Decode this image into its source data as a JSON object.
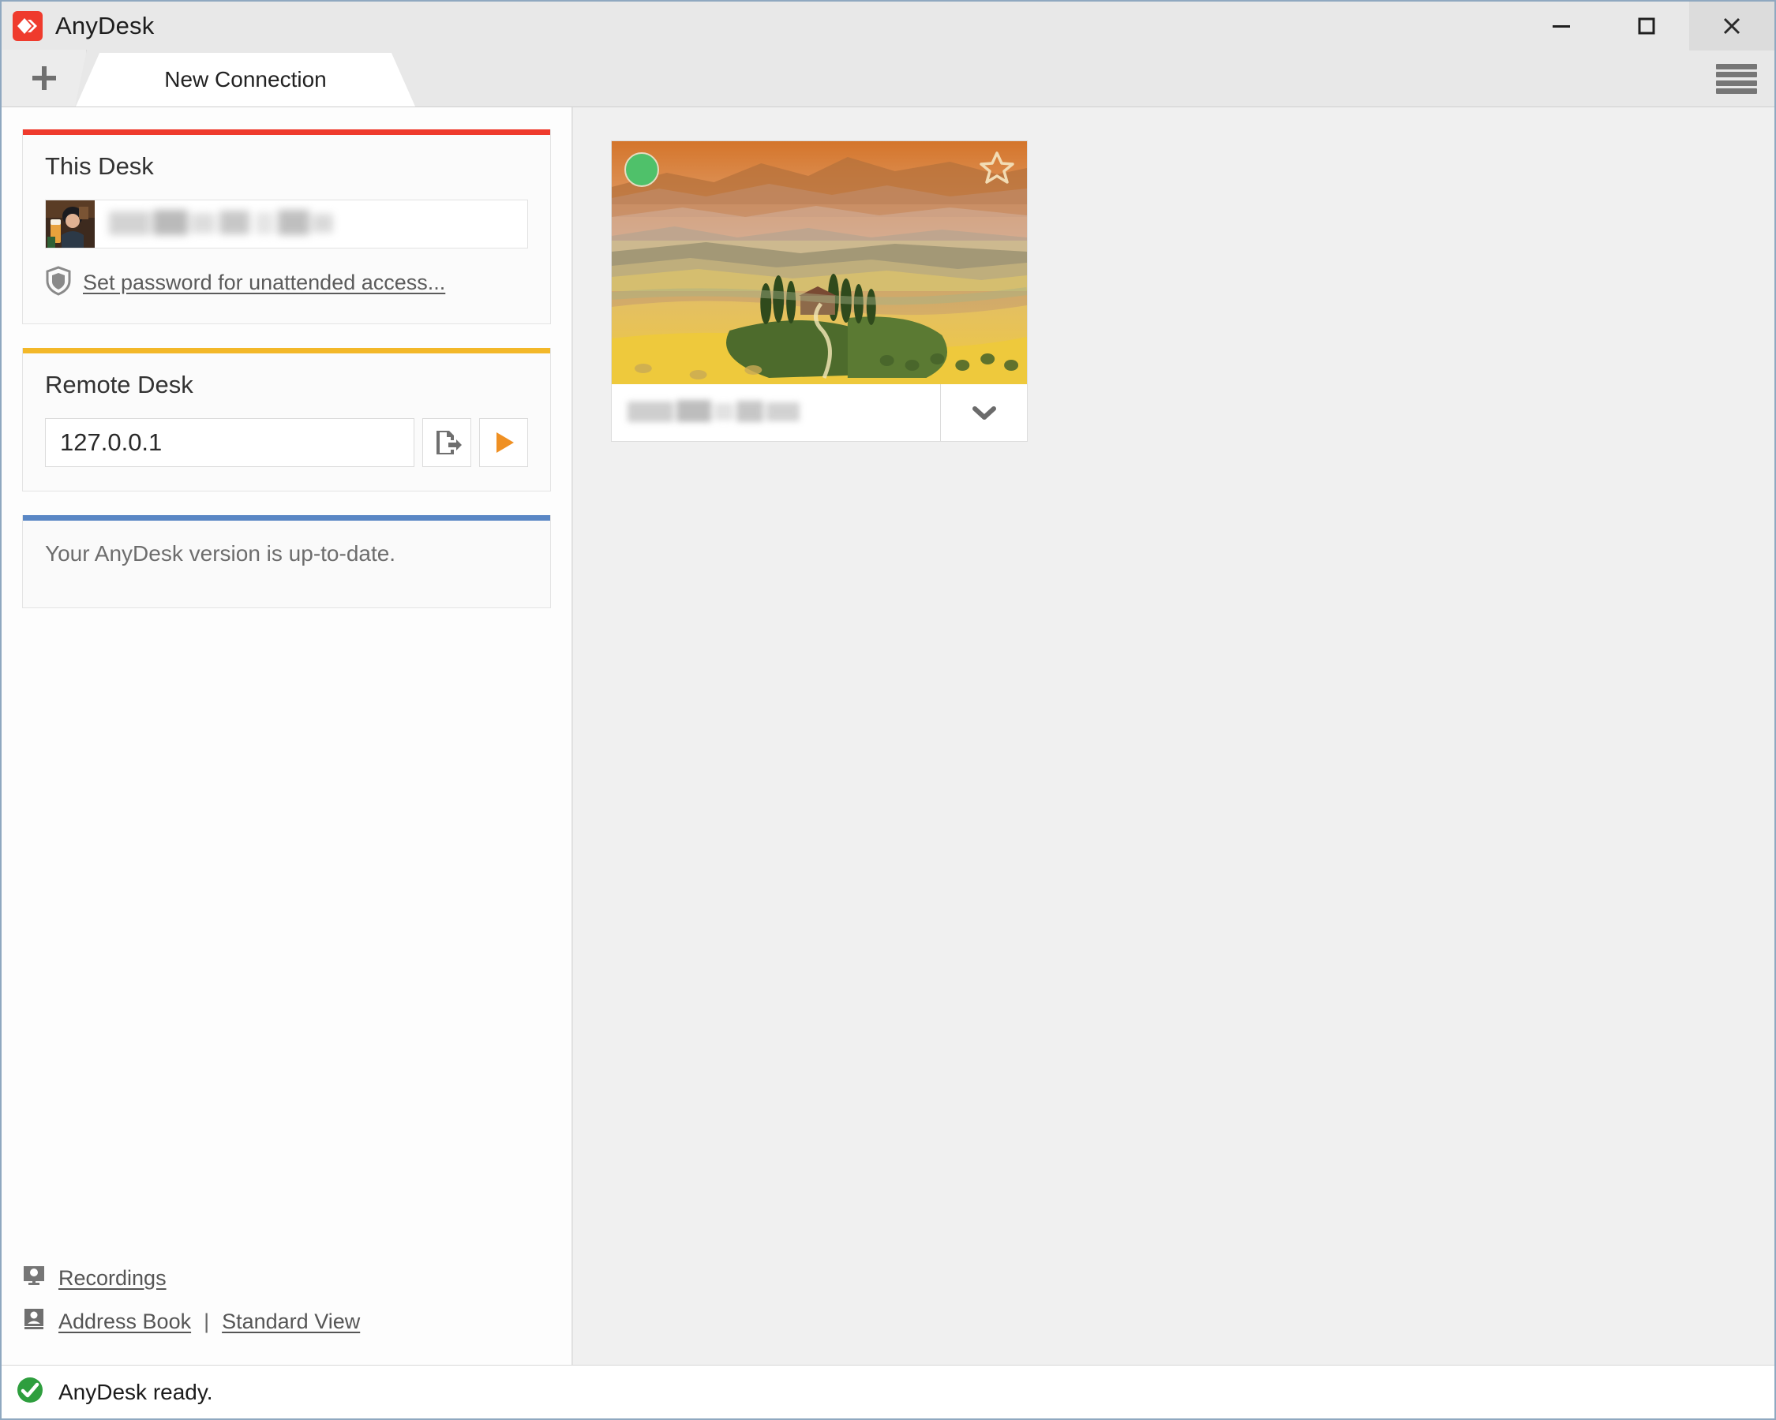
{
  "window": {
    "title": "AnyDesk",
    "logo_icon": "anydesk-logo-icon",
    "controls": {
      "minimize": "minimize-icon",
      "maximize": "maximize-icon",
      "close": "close-icon"
    },
    "menu_icon": "hamburger-menu-icon"
  },
  "tabs": {
    "new_tab_label": "+",
    "new_tab_icon": "plus-icon",
    "active_tab": "New Connection"
  },
  "this_desk": {
    "title": "This Desk",
    "accent_color": "#ef3b2d",
    "avatar_icon": "user-avatar",
    "id_value_hidden": true,
    "password_link": "Set password for unattended access...",
    "shield_icon": "shield-icon"
  },
  "remote_desk": {
    "title": "Remote Desk",
    "accent_color": "#f3b829",
    "address_value": "127.0.0.1",
    "address_placeholder": "Remote Address",
    "file_transfer_icon": "file-transfer-icon",
    "connect_icon": "play-connect-icon"
  },
  "update_panel": {
    "accent_color": "#5a87c5",
    "message": "Your AnyDesk version is up-to-date."
  },
  "bottom_links": {
    "recordings": "Recordings",
    "recordings_icon": "monitor-recordings-icon",
    "address_book": "Address Book",
    "address_book_icon": "address-book-icon",
    "separator": "|",
    "standard_view": "Standard View"
  },
  "session_card": {
    "thumbnail_icon": "tuscany-landscape-thumbnail",
    "online_indicator": "online-status-dot",
    "online_color": "#4fc16a",
    "favorite_icon": "favorite-star-icon",
    "favorite_color": "#f0dcb0",
    "label_hidden": true,
    "dropdown_icon": "chevron-down-icon"
  },
  "statusbar": {
    "icon": "ready-check-icon",
    "icon_color": "#2e9e3e",
    "message": "AnyDesk ready."
  }
}
